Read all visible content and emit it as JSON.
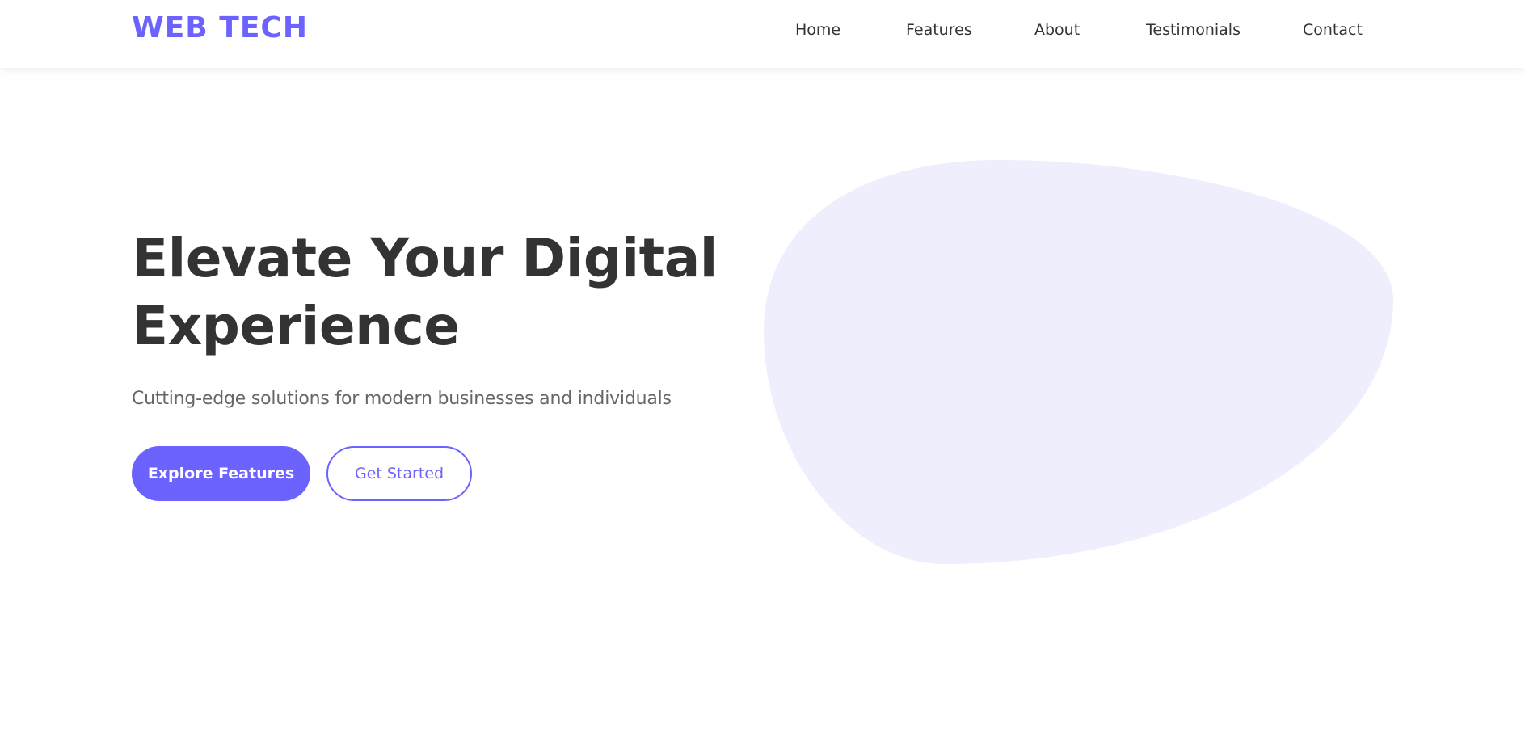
{
  "nav": {
    "logo": "WEB TECH",
    "links": [
      "Home",
      "Features",
      "About",
      "Testimonials",
      "Contact"
    ]
  },
  "hero": {
    "title_line1": "Elevate Your Digital",
    "title_line2": "Experience",
    "subtitle": "Cutting-edge solutions for modern businesses and individuals",
    "primary_button": "Explore Features",
    "secondary_button": "Get Started"
  },
  "colors": {
    "accent": "#6c63ff",
    "text_dark": "#333333",
    "text_muted": "#666666",
    "blob_fill": "#efeefd",
    "background": "#ffffff"
  },
  "decoration": {
    "blob_icon": "blob-shape"
  }
}
